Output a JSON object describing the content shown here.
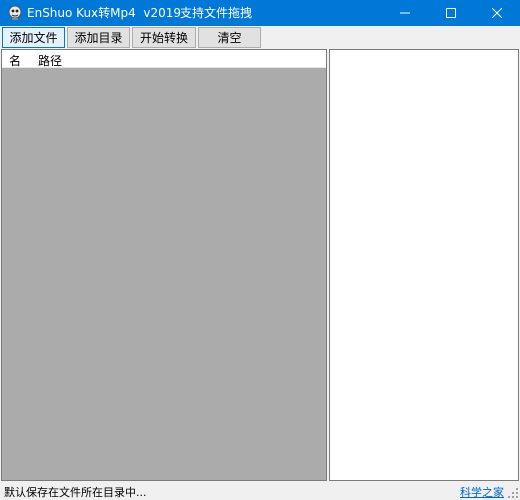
{
  "window": {
    "title": "EnShuo Kux转Mp4  v2019",
    "hint": "支持文件拖拽",
    "accent_color": "#0078d7",
    "icons": {
      "app": "app-icon",
      "minimize": "minimize-icon",
      "maximize": "maximize-icon",
      "close": "close-icon"
    }
  },
  "toolbar": {
    "add_file": "添加文件",
    "add_folder": "添加目录",
    "start_convert": "开始转换",
    "clear": "清空"
  },
  "file_list": {
    "columns": [
      "名",
      "路径"
    ],
    "background_color": "#ababab"
  },
  "statusbar": {
    "text": "默认保存在文件所在目录中...",
    "link": "科学之家",
    "link_color": "#0066cc"
  }
}
